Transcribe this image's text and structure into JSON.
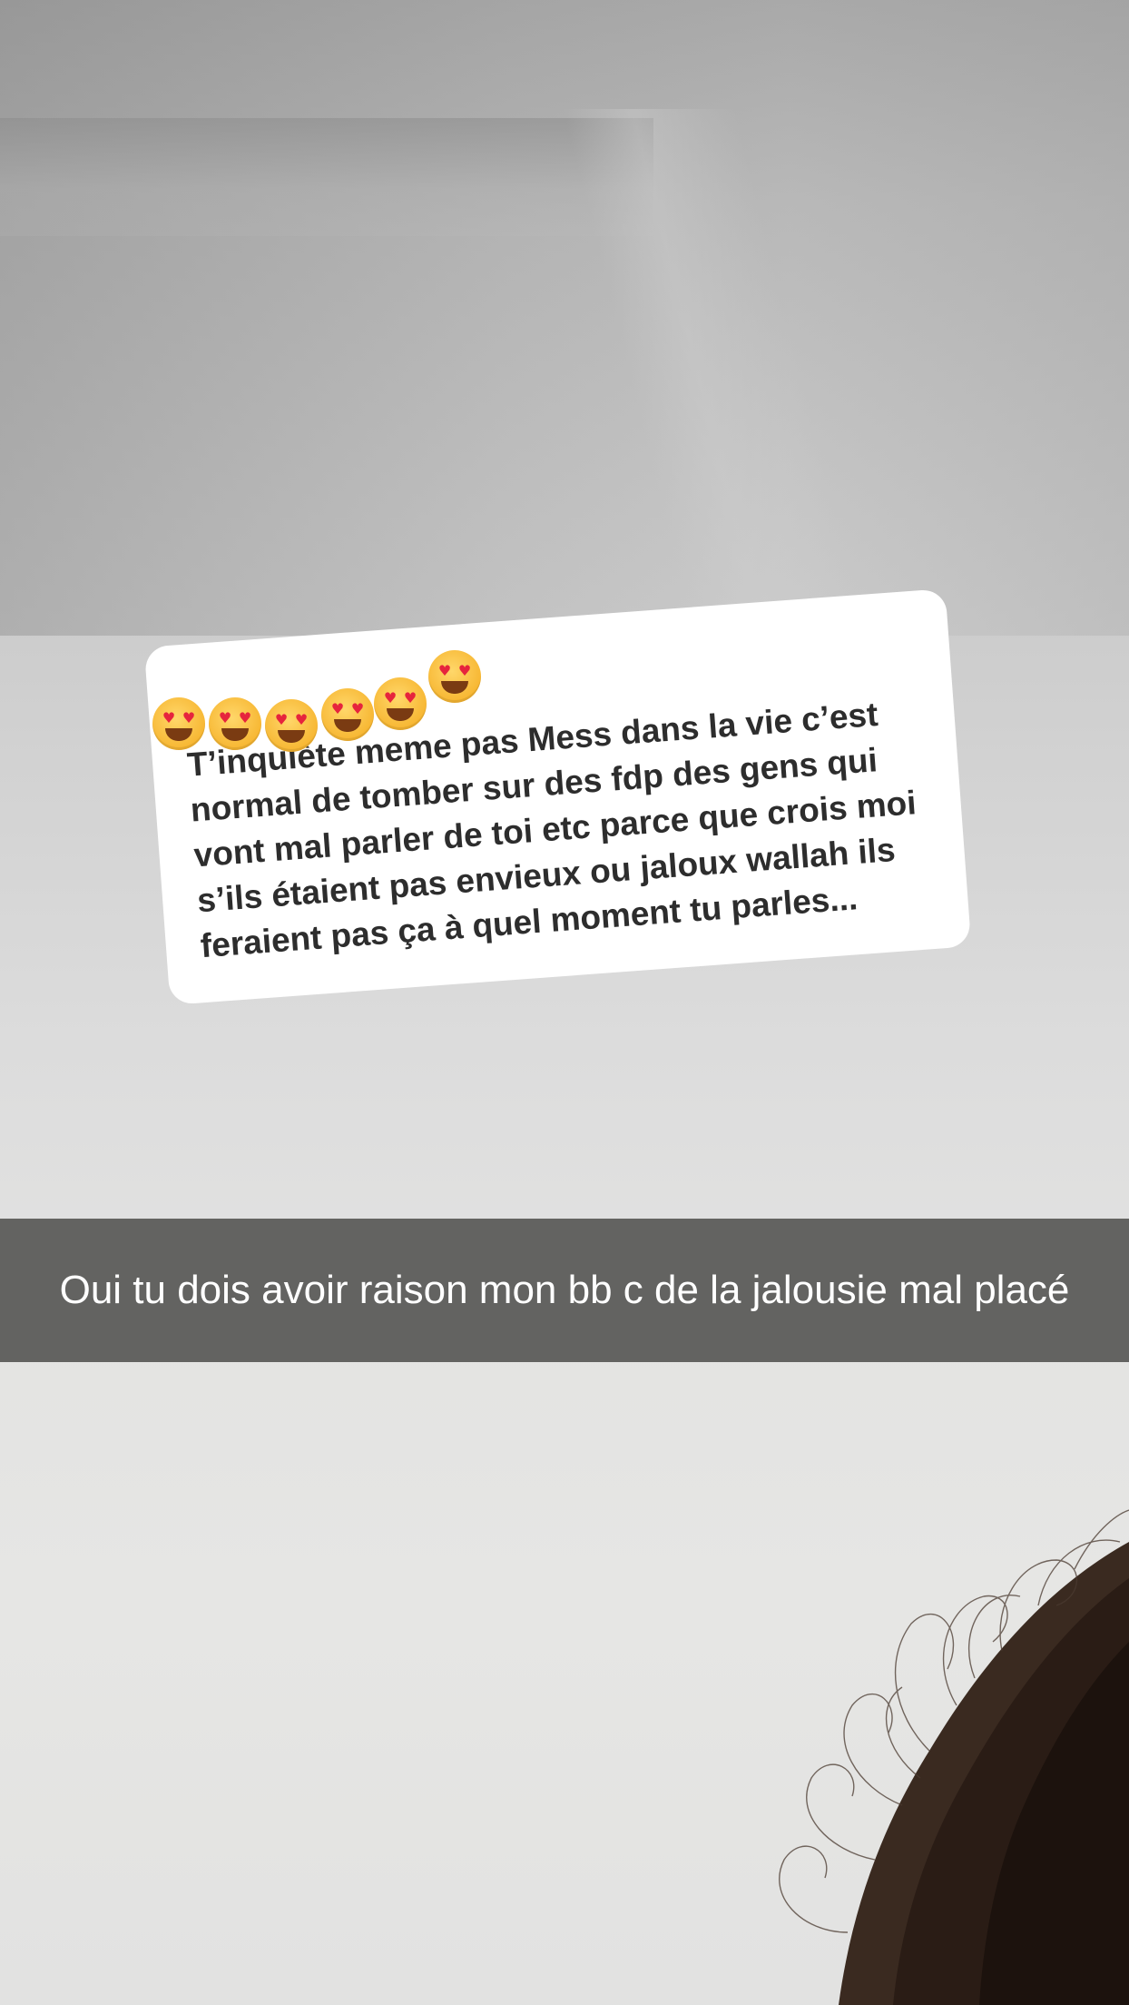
{
  "reply_sticker": {
    "emojis": [
      "😍",
      "😍",
      "😍",
      "😍",
      "😍",
      "😍"
    ],
    "message": "T’inquiète meme pas Mess dans la vie c’est normal de tomber sur des fdp des gens qui vont mal parler de toi etc parce que crois moi s’ils étaient pas envieux ou jaloux wallah ils feraient pas ça à quel moment tu parles..."
  },
  "caption": {
    "text": "Oui tu dois avoir raison mon bb c de la jalousie mal placé"
  },
  "icons": {
    "emoji": "heart-eyes-emoji-icon"
  }
}
